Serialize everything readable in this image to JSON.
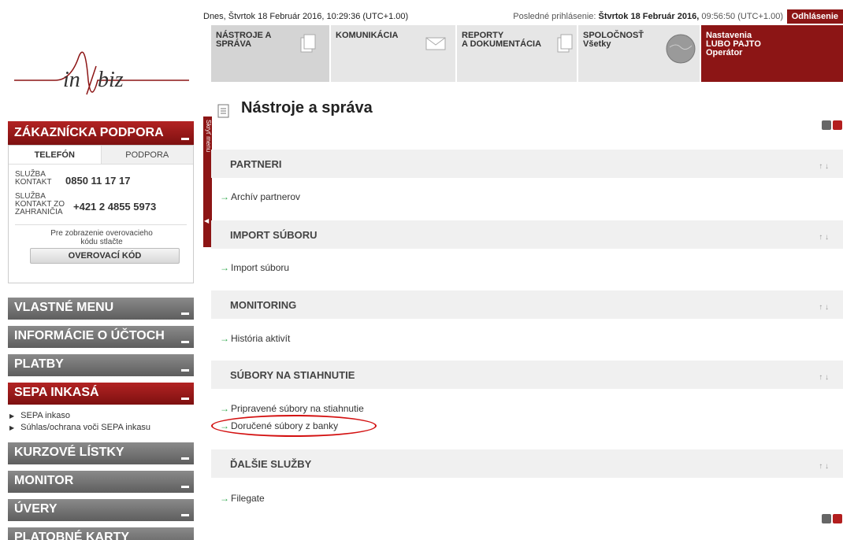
{
  "topbar": {
    "today": "Dnes, Štvrtok 18 Február 2016, 10:29:36 (UTC+1.00)",
    "last_login_label": "Posledné prihlásenie:",
    "last_login_value": "Štvrtok 18 Február 2016,",
    "last_login_time": "09:56:50 (UTC+1.00)",
    "logout": "Odhlásenie"
  },
  "logo": {
    "text": "in|biz",
    "brand_color": "#8c1515"
  },
  "support": {
    "header": "ZÁKAZNÍCKA PODPORA",
    "tab_phone": "TELEFÓN",
    "tab_support": "PODPORA",
    "row1_label_l1": "SLUŽBA",
    "row1_label_l2": "KONTAKT",
    "row1_number": "0850 11 17 17",
    "row2_label_l1": "SLUŽBA",
    "row2_label_l2": "KONTAKT ZO",
    "row2_label_l3": "ZAHRANIČIA",
    "row2_number": "+421 2 4855 5973",
    "verify_text_l1": "Pre zobrazenie overovacieho",
    "verify_text_l2": "kódu stlačte",
    "verify_button": "OVEROVACÍ KÓD"
  },
  "sidebar_menu": {
    "own_menu": "VLASTNÉ MENU",
    "accounts": "INFORMÁCIE O ÚČTOCH",
    "payments": "PLATBY",
    "sepa": "SEPA INKASÁ",
    "sepa_sub1": "SEPA inkaso",
    "sepa_sub2": "Súhlas/ochrana voči SEPA inkasu",
    "rates": "KURZOVÉ LÍSTKY",
    "monitor": "MONITOR",
    "loans": "ÚVERY",
    "cards": "PLATOBNÉ KARTY"
  },
  "hide_menu": "Skryť menu",
  "nav": {
    "tools_l1": "NÁSTROJE A",
    "tools_l2": "SPRÁVA",
    "communication": "KOMUNIKÁCIA",
    "reports_l1": "REPORTY",
    "reports_l2": "A DOKUMENTÁCIA",
    "company_l1": "SPOLOČNOSŤ",
    "company_l2": "Všetky",
    "settings_l1": "Nastavenia",
    "settings_l2": "LUBO PAJTO",
    "settings_l3": "Operátor"
  },
  "main": {
    "title": "Nástroje a správa",
    "sections": [
      {
        "title": "PARTNERI",
        "links": [
          "Archív partnerov"
        ]
      },
      {
        "title": "IMPORT SÚBORU",
        "links": [
          "Import súboru"
        ]
      },
      {
        "title": "MONITORING",
        "links": [
          "História aktivít"
        ]
      },
      {
        "title": "SÚBORY NA STIAHNUTIE",
        "links": [
          "Pripravené súbory na stiahnutie",
          "Doručené súbory z banky"
        ]
      },
      {
        "title": "ĎALŠIE SLUŽBY",
        "links": [
          "Filegate"
        ]
      }
    ],
    "section_arrows": "↑ ↓"
  },
  "colors": {
    "accent_red": "#8c1515",
    "link_arrow_green": "#2ea84a",
    "highlight": "#d31010"
  }
}
